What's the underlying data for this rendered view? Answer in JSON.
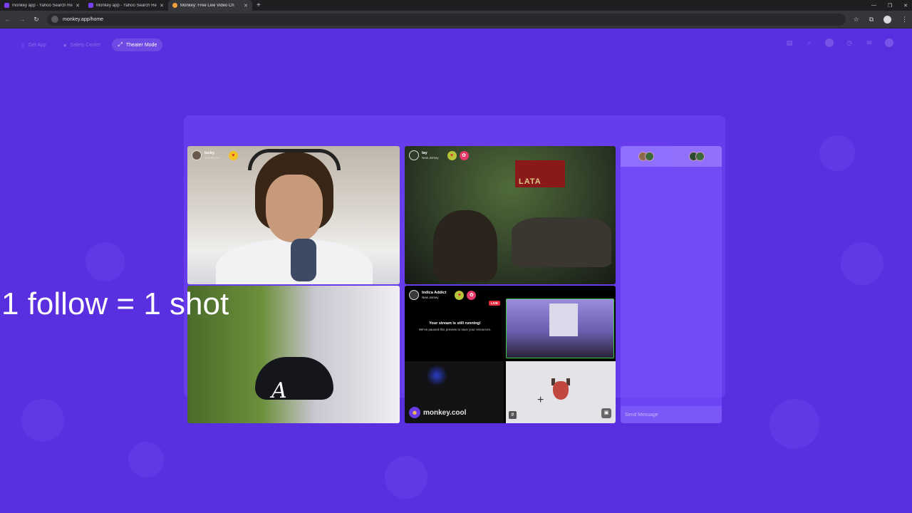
{
  "browser": {
    "tabs": [
      {
        "title": "monkey app - Yahoo Search Re",
        "active": false
      },
      {
        "title": "Monkey app - Yahoo Search Re",
        "active": false
      },
      {
        "title": "Monkey: Free Live Video Ch",
        "active": true
      }
    ],
    "new_tab_icon": "plus-icon",
    "url": "monkey.app/home"
  },
  "topnav": {
    "get_app": "Get App",
    "safety_center": "Safety Center",
    "theater_mode": "Theater Mode"
  },
  "tiles": {
    "t1": {
      "name": "lucky",
      "location": "Tennessee"
    },
    "t2": {
      "name": "lay",
      "location": "New Jersey"
    },
    "t4": {
      "name": "Indica Addict",
      "location": "New Jersey",
      "live": "LIVE",
      "paused_title": "Your stream is still running!",
      "paused_sub": "We've paused this preview to save your resources.",
      "brand": "monkey.cool"
    }
  },
  "scene_text": {
    "t2_banner": "LATA"
  },
  "chat": {
    "placeholder": "Send Message"
  },
  "overlay": {
    "caption": "1 follow = 1 shot"
  },
  "colors": {
    "page_bg": "#5a2fe0",
    "live_red": "#e52a3a",
    "accent_green": "#3fc94a"
  }
}
